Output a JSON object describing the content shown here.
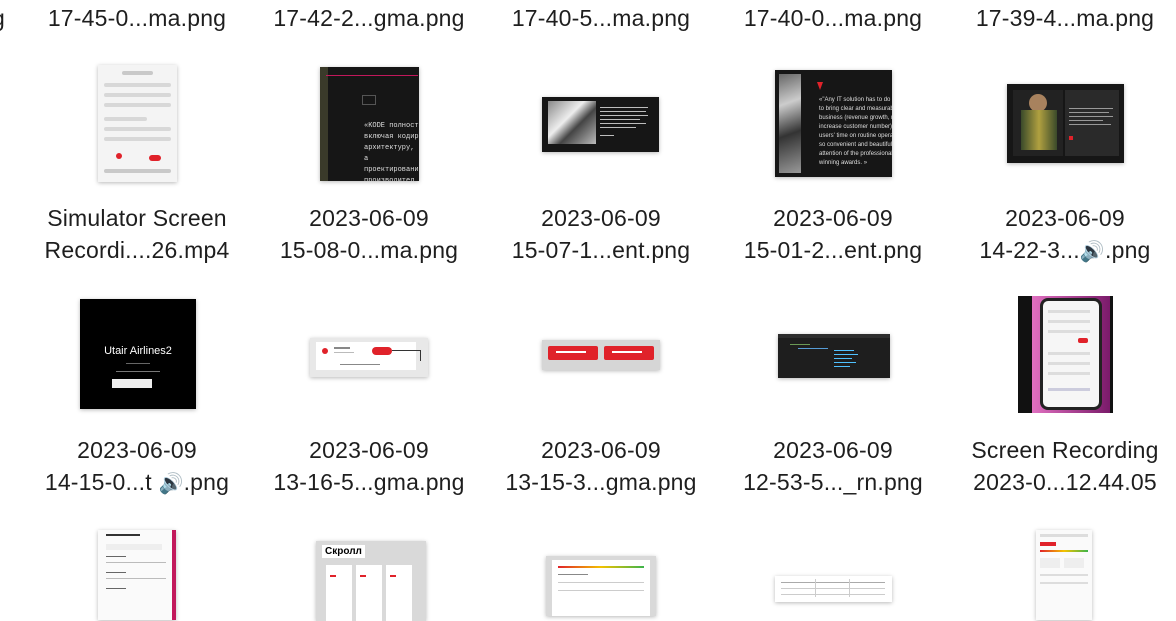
{
  "row0": [
    {
      "label": "17-45-0...ma.png"
    },
    {
      "label": "17-42-2...gma.png"
    },
    {
      "label": "17-40-5...ma.png"
    },
    {
      "label": "17-40-0...ma.png"
    },
    {
      "label": "17-39-4...ma.png"
    }
  ],
  "row1": [
    {
      "line1": "Simulator Screen",
      "line2": "Recordi....26.mp4",
      "thumb": "phone-ui"
    },
    {
      "line1": "2023-06-09",
      "line2": "15-08-0...ma.png",
      "thumb": "dark-red-frame"
    },
    {
      "line1": "2023-06-09",
      "line2": "15-07-1...ent.png",
      "thumb": "dark-laptop"
    },
    {
      "line1": "2023-06-09",
      "line2": "15-01-2...ent.png",
      "thumb": "dark-quote"
    },
    {
      "line1": "2023-06-09",
      "line2": "14-22-3...",
      "line2_suffix": ".png",
      "thumb": "dark-person"
    }
  ],
  "row2": [
    {
      "line1": "2023-06-09",
      "line2": "14-15-0...t ",
      "line2_suffix": ".png",
      "thumb": "black-title",
      "thumb_title": "Utair Airlines2"
    },
    {
      "line1": "2023-06-09",
      "line2": "13-16-5...gma.png",
      "thumb": "red-button"
    },
    {
      "line1": "2023-06-09",
      "line2": "13-15-3...gma.png",
      "thumb": "two-buttons"
    },
    {
      "line1": "2023-06-09",
      "line2": "12-53-5..._rn.png",
      "thumb": "code-editor"
    },
    {
      "line1": "Screen Recording",
      "line2": "2023-0...12.44.05",
      "thumb": "phone-recording"
    }
  ],
  "row3": [
    {
      "thumb": "list-ui"
    },
    {
      "thumb": "scroll-ui",
      "thumb_title": "Скролл"
    },
    {
      "thumb": "cards-ui"
    },
    {
      "thumb": "table-ui"
    },
    {
      "thumb": "phone-ui-2"
    }
  ],
  "icons": {
    "audio": "speaker-icon"
  },
  "colors": {
    "accent": "#e0222a"
  }
}
